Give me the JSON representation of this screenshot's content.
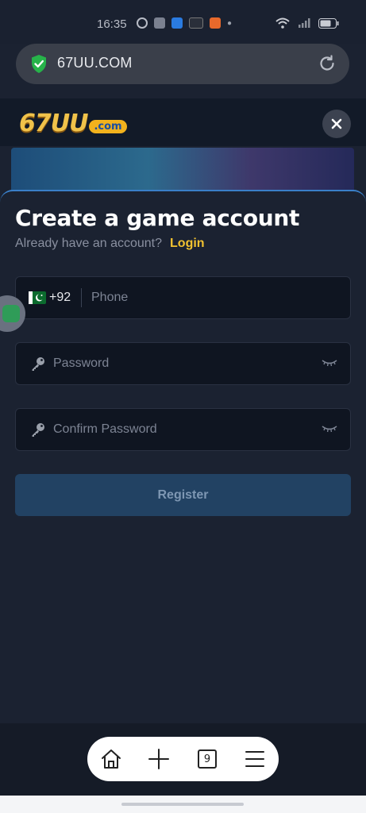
{
  "status_bar": {
    "time": "16:35"
  },
  "browser": {
    "url": "67UU.COM",
    "tab_count": "9"
  },
  "site": {
    "logo_main": "67UU",
    "logo_suffix": ".com"
  },
  "register": {
    "title": "Create a game account",
    "have_account": "Already have an account?",
    "login_label": "Login",
    "country_code": "+92",
    "phone_placeholder": "Phone",
    "password_placeholder": "Password",
    "confirm_placeholder": "Confirm Password",
    "register_label": "Register"
  },
  "colors": {
    "accent": "#f2c230",
    "background": "#1b2231",
    "button": "#224263"
  }
}
